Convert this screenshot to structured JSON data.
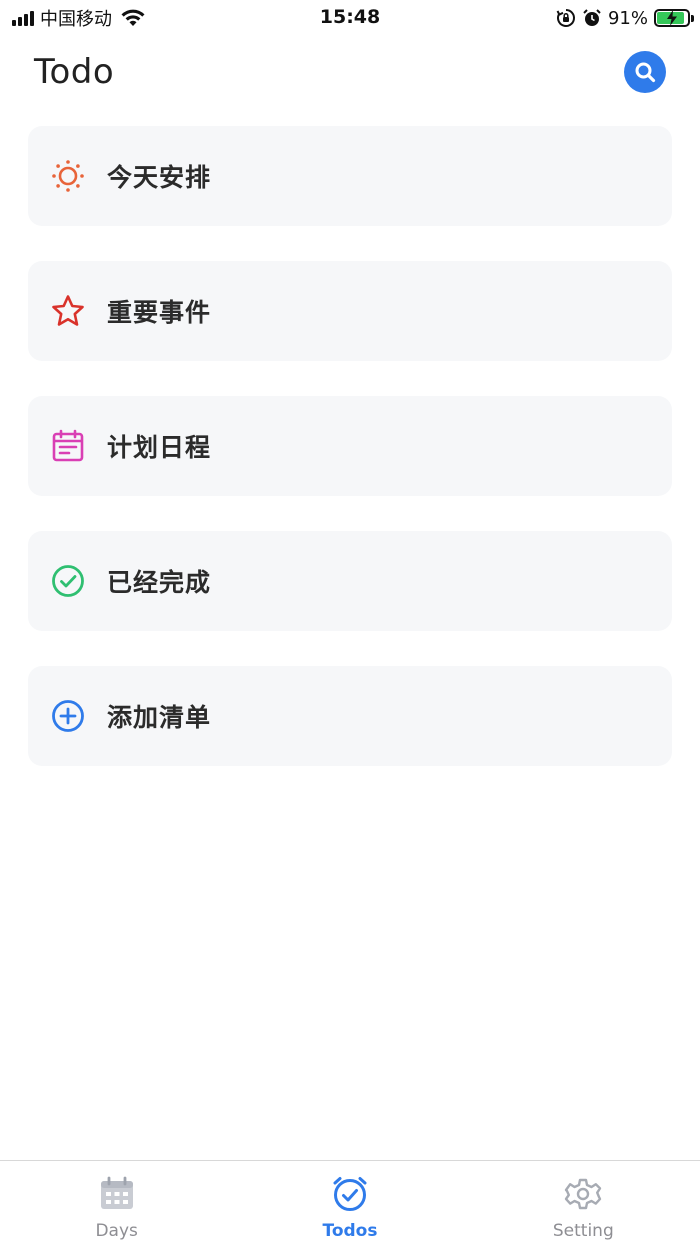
{
  "status_bar": {
    "carrier": "中国移动",
    "time": "15:48",
    "battery_percent": "91%",
    "battery_level": 0.91
  },
  "header": {
    "title": "Todo"
  },
  "lists": [
    {
      "label": "今天安排",
      "icon": "sun-icon",
      "color": "#e8643a"
    },
    {
      "label": "重要事件",
      "icon": "star-icon",
      "color": "#d9322b"
    },
    {
      "label": "计划日程",
      "icon": "calendar-icon",
      "color": "#d93fb4"
    },
    {
      "label": "已经完成",
      "icon": "check-circle-icon",
      "color": "#2fbf71"
    },
    {
      "label": "添加清单",
      "icon": "plus-circle-icon",
      "color": "#2f7bea"
    }
  ],
  "tabs": [
    {
      "label": "Days",
      "icon": "calendar-grid-icon",
      "active": false
    },
    {
      "label": "Todos",
      "icon": "alarm-check-icon",
      "active": true
    },
    {
      "label": "Setting",
      "icon": "gear-icon",
      "active": false
    }
  ],
  "colors": {
    "accent": "#2f7bea",
    "card_bg": "#f6f7f9",
    "tab_inactive": "#8e8e93"
  }
}
